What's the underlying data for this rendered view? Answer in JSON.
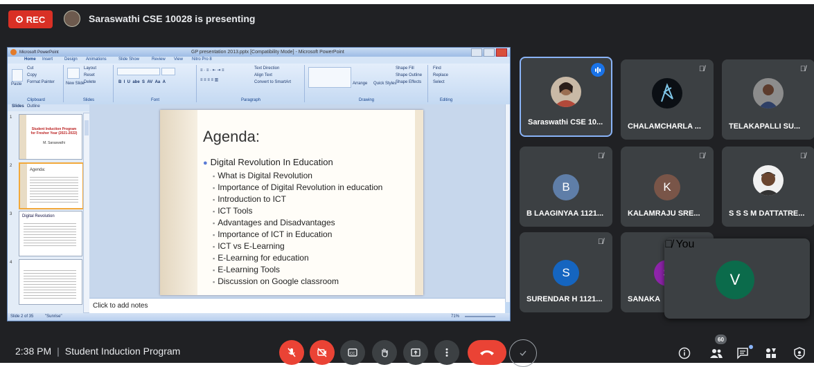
{
  "recording": {
    "label": "REC"
  },
  "presenter": {
    "text": "Saraswathi CSE 10028 is presenting"
  },
  "ppt": {
    "app_title": "Microsoft PowerPoint",
    "window_title": "GP presentation 2013.pptx [Compatibility Mode] - Microsoft PowerPoint",
    "tabs": [
      "Home",
      "Insert",
      "Design",
      "Animations",
      "Slide Show",
      "Review",
      "View",
      "Nitro Pro 8"
    ],
    "ribbon": {
      "clipboard": {
        "cut": "Cut",
        "copy": "Copy",
        "paste": "Paste",
        "format_painter": "Format Painter",
        "label": "Clipboard"
      },
      "slides": {
        "new_slide": "New Slide",
        "layout": "Layout",
        "reset": "Reset",
        "delete": "Delete",
        "label": "Slides"
      },
      "font": {
        "label": "Font"
      },
      "paragraph": {
        "text_direction": "Text Direction",
        "align_text": "Align Text",
        "smartart": "Convert to SmartArt",
        "label": "Paragraph"
      },
      "drawing": {
        "arrange": "Arrange",
        "quick_styles": "Quick Styles",
        "shape_fill": "Shape Fill",
        "shape_outline": "Shape Outline",
        "shape_effects": "Shape Effects",
        "label": "Drawing"
      },
      "editing": {
        "find": "Find",
        "replace": "Replace",
        "select": "Select",
        "label": "Editing"
      }
    },
    "panel_tabs": {
      "slides": "Slides",
      "outline": "Outline"
    },
    "thumbs": [
      {
        "num": "1",
        "title": "Student Induction Program for Fresher Year (2021-2022)",
        "name": "M. Saraswathi"
      },
      {
        "num": "2",
        "title": "Agenda:"
      },
      {
        "num": "3",
        "title": "Digital Revolution"
      },
      {
        "num": "4",
        "title": ""
      }
    ],
    "slide": {
      "title": "Agenda:",
      "main_bullet": "Digital Revolution In Education",
      "sub_bullets": [
        "What is Digital Revolution",
        "Importance of Digital Revolution in education",
        "Introduction to ICT",
        "ICT Tools",
        "Advantages and Disadvantages",
        "Importance of ICT in Education",
        "ICT vs E-Learning",
        "E-Learning for education",
        "E-Learning Tools",
        "Discussion on Google classroom"
      ]
    },
    "notes_placeholder": "Click to add notes",
    "status": {
      "slide_count": "Slide 2 of 35",
      "theme": "\"Sunrise\"",
      "zoom": "71%"
    }
  },
  "participants": [
    {
      "name": "Saraswathi CSE 10...",
      "kind": "photo",
      "speaking": true
    },
    {
      "name": "CHALAMCHARLA ...",
      "kind": "dark-photo"
    },
    {
      "name": "TELAKAPALLI SU...",
      "kind": "photo2"
    },
    {
      "name": "B LAAGINYAA 1121...",
      "initial": "B",
      "color": "#5f7ea8"
    },
    {
      "name": "KALAMRAJU SRE...",
      "initial": "K",
      "color": "#795548"
    },
    {
      "name": "S S S M DATTATRE...",
      "kind": "photo3"
    },
    {
      "name": "SURENDAR H 1121...",
      "initial": "S",
      "color": "#1565c0"
    },
    {
      "name": "SANAKA",
      "initial": "S",
      "color": "#8e24aa"
    }
  ],
  "self_view": {
    "initial": "V",
    "label": "You",
    "color": "#0b6b4b"
  },
  "bottom": {
    "time": "2:38 PM",
    "separator": "|",
    "meeting": "Student Induction Program",
    "participants_count": "60"
  },
  "colors": {
    "meet_bg": "#202124",
    "tile_bg": "#3c4043",
    "red": "#ea4335",
    "accent": "#8ab4f8"
  },
  "icons": [
    "mic-off-icon",
    "camera-off-icon",
    "captions-icon",
    "raise-hand-icon",
    "present-icon",
    "more-icon",
    "end-call-icon",
    "info-icon",
    "people-icon",
    "chat-icon",
    "activities-icon",
    "host-controls-icon"
  ]
}
